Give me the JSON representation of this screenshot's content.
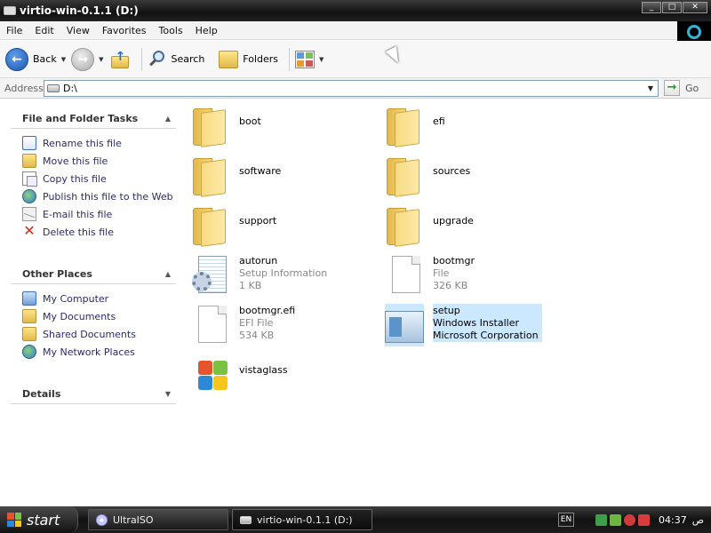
{
  "window": {
    "title": "virtio-win-0.1.1 (D:)",
    "controls": {
      "minimize": "_",
      "maximize": "□",
      "close": "✕"
    }
  },
  "menubar": {
    "items": [
      "File",
      "Edit",
      "View",
      "Favorites",
      "Tools",
      "Help"
    ]
  },
  "toolbar": {
    "back_label": "Back",
    "search_label": "Search",
    "folders_label": "Folders"
  },
  "address": {
    "label": "Address",
    "value": "D:\\",
    "go_label": "Go"
  },
  "taskpane": {
    "file_tasks": {
      "title": "File and Folder Tasks",
      "items": [
        {
          "label": "Rename this file",
          "icon": "rename-icon"
        },
        {
          "label": "Move this file",
          "icon": "move-icon"
        },
        {
          "label": "Copy this file",
          "icon": "copy-icon"
        },
        {
          "label": "Publish this file to the Web",
          "icon": "web-publish-icon"
        },
        {
          "label": "E-mail this file",
          "icon": "email-icon"
        },
        {
          "label": "Delete this file",
          "icon": "delete-icon"
        }
      ]
    },
    "other_places": {
      "title": "Other Places",
      "items": [
        {
          "label": "My Computer",
          "icon": "computer-icon"
        },
        {
          "label": "My Documents",
          "icon": "documents-icon"
        },
        {
          "label": "Shared Documents",
          "icon": "shared-folder-icon"
        },
        {
          "label": "My Network Places",
          "icon": "network-icon"
        }
      ]
    },
    "details": {
      "title": "Details"
    }
  },
  "files": [
    {
      "name": "boot",
      "type": "folder"
    },
    {
      "name": "efi",
      "type": "folder"
    },
    {
      "name": "software",
      "type": "folder"
    },
    {
      "name": "sources",
      "type": "folder"
    },
    {
      "name": "support",
      "type": "folder"
    },
    {
      "name": "upgrade",
      "type": "folder"
    },
    {
      "name": "autorun",
      "line2": "Setup Information",
      "line3": "1 KB",
      "type": "setup-info"
    },
    {
      "name": "bootmgr",
      "line2": "File",
      "line3": "326 KB",
      "type": "file"
    },
    {
      "name": "bootmgr.efi",
      "line2": "EFI File",
      "line3": "534 KB",
      "type": "file"
    },
    {
      "name": "setup",
      "line2": "Windows Installer",
      "line3": "Microsoft Corporation",
      "type": "installer",
      "selected": true
    },
    {
      "name": "vistaglass",
      "type": "application"
    }
  ],
  "taskbar": {
    "start_label": "start",
    "tasks": [
      {
        "label": "UltraISO",
        "icon": "disc-icon"
      },
      {
        "label": "virtio-win-0.1.1 (D:)",
        "icon": "drive-icon",
        "active": true
      }
    ],
    "language": "EN",
    "clock": "04:37",
    "clock_suffix": "ص"
  },
  "colors": {
    "selection": "#cce8ff",
    "link_text": "#2a2a6e",
    "titlebar": "#111111"
  }
}
